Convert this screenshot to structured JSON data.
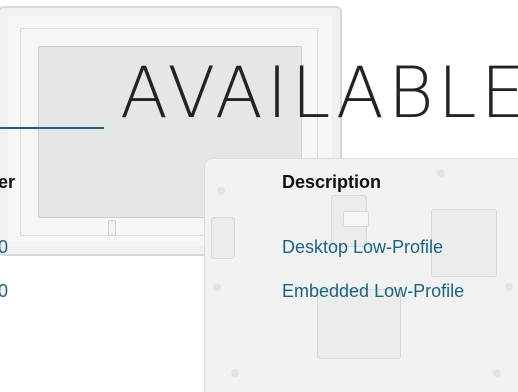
{
  "heading": {
    "text": "AVAILABLE"
  },
  "table": {
    "columns": [
      "er",
      "Description"
    ],
    "rows": [
      {
        "number": "0",
        "description": "Desktop Low-Profile"
      },
      {
        "number": "0",
        "description": "Embedded Low-Profile"
      }
    ]
  },
  "colors": {
    "accent": "#1f5f80",
    "link": "#1a6385",
    "heading": "#232323"
  }
}
